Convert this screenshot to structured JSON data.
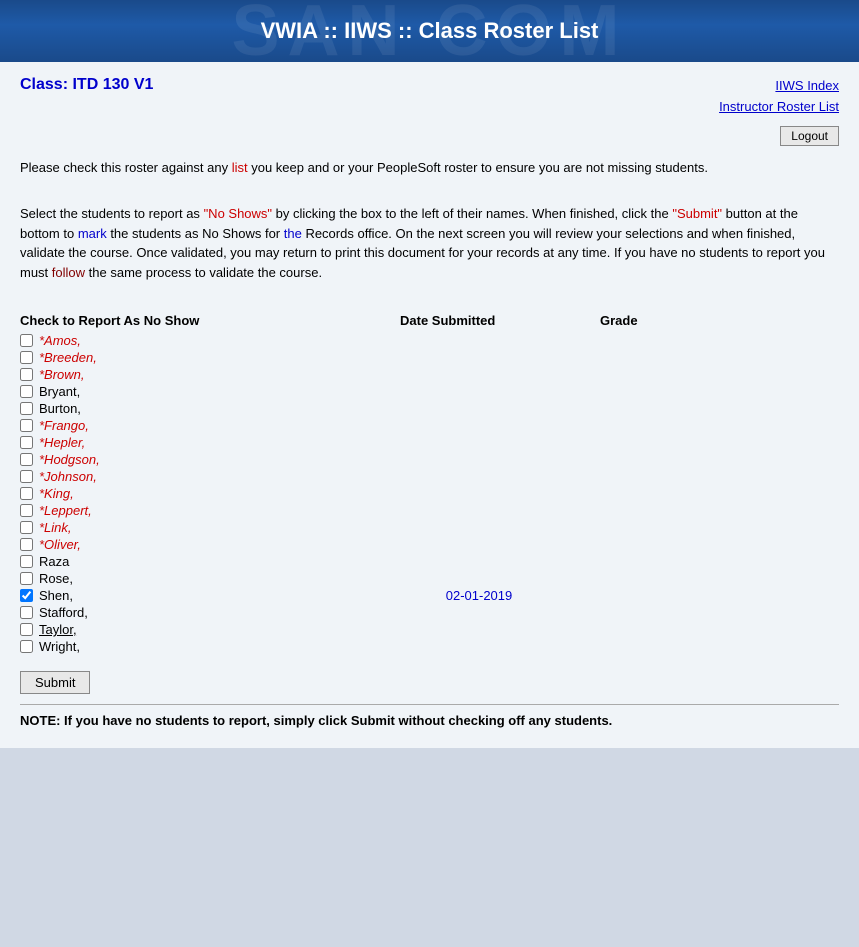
{
  "header": {
    "title": "VWIA :: IIWS :: Class Roster List",
    "watermark": "SAN COMÓ"
  },
  "nav": {
    "iiws_index": "IIWS Index",
    "instructor_roster": "Instructor Roster List",
    "logout": "Logout"
  },
  "class": {
    "label": "Class:",
    "name": "ITD 130 V1"
  },
  "instructions": {
    "para1": "Please check this roster against any list you keep and or your PeopleSoft roster to ensure you are not missing students.",
    "para2_1": "Select the students to report as ",
    "para2_quoted": "\"No Shows\"",
    "para2_2": " by clicking the box to the left of their names. When finished, click the ",
    "para2_submit": "\"Submit\"",
    "para2_3": " button at the bottom to mark the students as No Shows for the Records office. On the next screen you will review your selections and when finished, validate the course. Once validated, you may return to print this document for your records at any time. If you have no students to report you must follow the same process to validate the course."
  },
  "table": {
    "col_name": "Check to Report As No Show",
    "col_date": "Date Submitted",
    "col_grade": "Grade"
  },
  "students": [
    {
      "name": "*Amos,",
      "italic": true,
      "checked": false,
      "date": "",
      "grade": ""
    },
    {
      "name": "*Breeden,",
      "italic": true,
      "checked": false,
      "date": "",
      "grade": ""
    },
    {
      "name": "*Brown,",
      "italic": true,
      "checked": false,
      "date": "",
      "grade": ""
    },
    {
      "name": "Bryant,",
      "italic": false,
      "checked": false,
      "date": "",
      "grade": ""
    },
    {
      "name": "Burton,",
      "italic": false,
      "checked": false,
      "date": "",
      "grade": ""
    },
    {
      "name": "*Frango,",
      "italic": true,
      "checked": false,
      "date": "",
      "grade": ""
    },
    {
      "name": "*Hepler,",
      "italic": true,
      "checked": false,
      "date": "",
      "grade": ""
    },
    {
      "name": "*Hodgson,",
      "italic": true,
      "checked": false,
      "date": "",
      "grade": ""
    },
    {
      "name": "*Johnson,",
      "italic": true,
      "checked": false,
      "date": "",
      "grade": ""
    },
    {
      "name": "*King,",
      "italic": true,
      "checked": false,
      "date": "",
      "grade": ""
    },
    {
      "name": "*Leppert,",
      "italic": true,
      "checked": false,
      "date": "",
      "grade": ""
    },
    {
      "name": "*Link,",
      "italic": true,
      "checked": false,
      "date": "",
      "grade": ""
    },
    {
      "name": "*Oliver,",
      "italic": true,
      "checked": false,
      "date": "",
      "grade": ""
    },
    {
      "name": "Raza",
      "italic": false,
      "checked": false,
      "date": "",
      "grade": ""
    },
    {
      "name": "Rose,",
      "italic": false,
      "checked": false,
      "date": "",
      "grade": ""
    },
    {
      "name": "Shen,",
      "italic": false,
      "checked": true,
      "date": "02-01-2019",
      "grade": ""
    },
    {
      "name": "Stafford,",
      "italic": false,
      "checked": false,
      "date": "",
      "grade": ""
    },
    {
      "name": "Taylor,",
      "italic": false,
      "checked": false,
      "date": "",
      "grade": "",
      "underline": true
    },
    {
      "name": "Wright,",
      "italic": false,
      "checked": false,
      "date": "",
      "grade": ""
    }
  ],
  "submit": {
    "label": "Submit"
  },
  "note": {
    "text": "NOTE: If you have no students to report, simply click Submit without checking off any students."
  }
}
